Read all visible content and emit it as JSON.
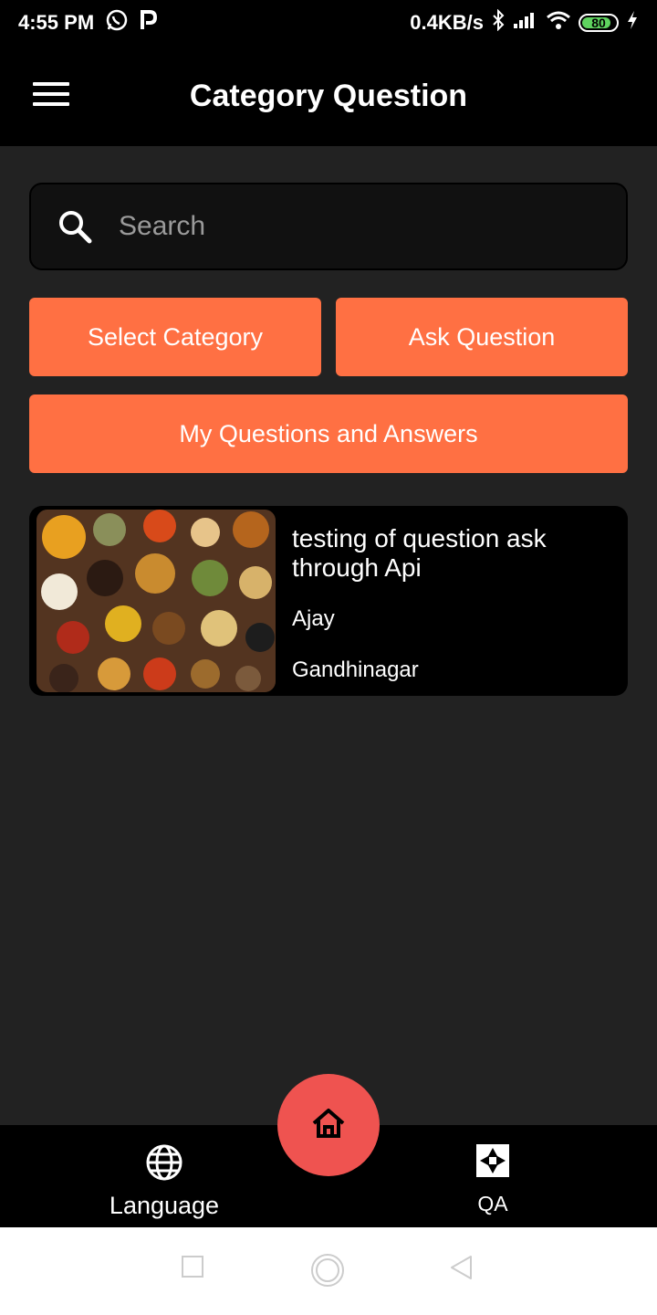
{
  "status_bar": {
    "time": "4:55 PM",
    "net_speed": "0.4KB/s",
    "battery": "80",
    "icons": [
      "whatsapp-icon",
      "p-app-icon",
      "bluetooth-icon",
      "signal-icon",
      "wifi-icon",
      "battery-icon",
      "charging-icon"
    ]
  },
  "app_bar": {
    "title": "Category Question",
    "menu_icon": "hamburger-menu-icon"
  },
  "search": {
    "placeholder": "Search",
    "icon": "search-icon"
  },
  "buttons": {
    "select_category": "Select Category",
    "ask_question": "Ask Question",
    "my_questions": "My Questions and Answers"
  },
  "questions": [
    {
      "title": "testing of question ask through Api",
      "user": "Ajay",
      "city": "Gandhinagar",
      "image": "spices-image"
    }
  ],
  "bottom_nav": {
    "language": "Language",
    "qa": "QA",
    "home_icon": "home-icon"
  },
  "colors": {
    "accent": "#ff7043",
    "fab": "#ef5350",
    "background": "#222222",
    "bar": "#000000"
  }
}
